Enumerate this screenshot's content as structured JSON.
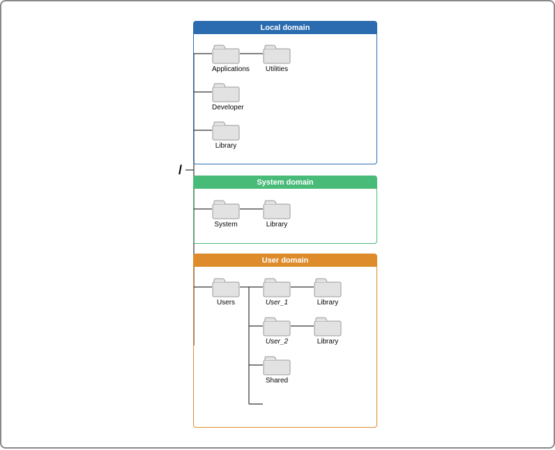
{
  "root": "/",
  "domains": {
    "local": {
      "title_plain": "Local ",
      "title_bold": "domain"
    },
    "system": {
      "title": "System domain"
    },
    "user": {
      "title": "User domain"
    }
  },
  "folders": {
    "apps": "Applications",
    "utils": "Utilities",
    "dev": "Developer",
    "lib_l": "Library",
    "system": "System",
    "lib_s": "Library",
    "users": "Users",
    "u1": "User_1",
    "u1_lib": "Library",
    "u2": "User_2",
    "u2_lib": "Library",
    "shared": "Shared"
  }
}
